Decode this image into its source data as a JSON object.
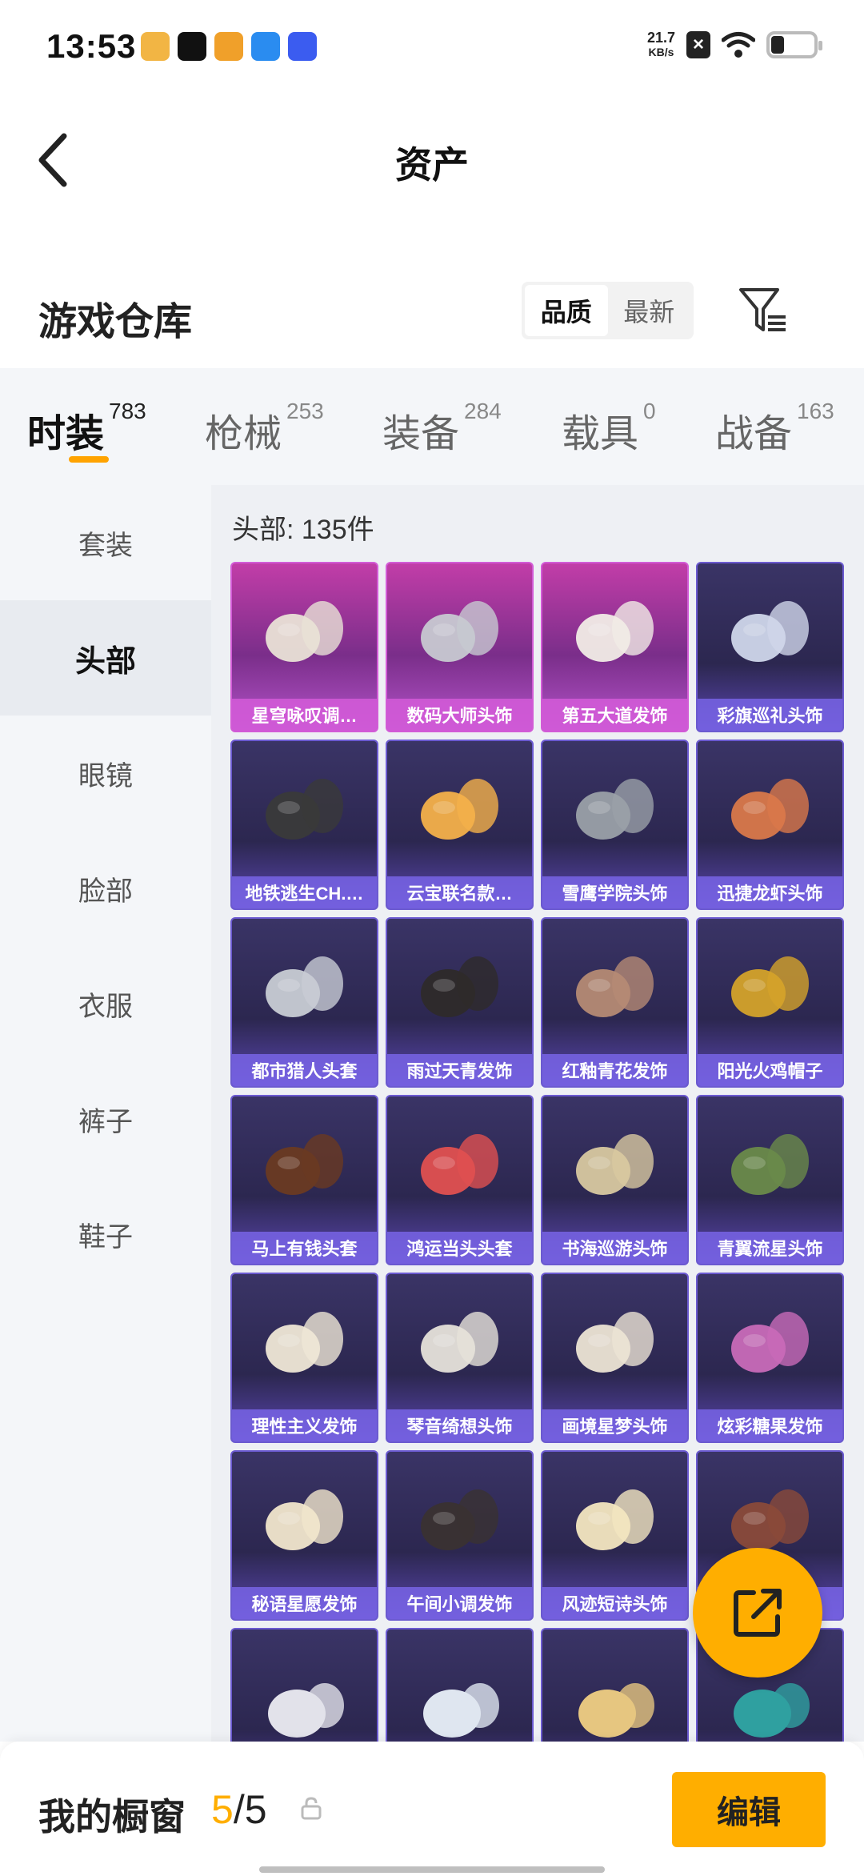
{
  "status": {
    "time": "13:53",
    "speed_top": "21.7",
    "speed_bottom": "KB/s",
    "icons": [
      "app-icon",
      "app-icon",
      "app-icon",
      "app-icon",
      "app-icon",
      "close-icon",
      "wifi-icon",
      "battery-icon"
    ]
  },
  "header": {
    "title": "资产"
  },
  "warehouse": {
    "title": "游戏仓库",
    "sort_quality": "品质",
    "sort_newest": "最新"
  },
  "tabs": [
    {
      "label": "时装",
      "count": "783"
    },
    {
      "label": "枪械",
      "count": "253"
    },
    {
      "label": "装备",
      "count": "284"
    },
    {
      "label": "载具",
      "count": "0"
    },
    {
      "label": "战备",
      "count": "163"
    }
  ],
  "sidebar": [
    "套装",
    "头部",
    "眼镜",
    "脸部",
    "衣服",
    "裤子",
    "鞋子"
  ],
  "content": {
    "title": "头部: 135件",
    "items": [
      {
        "name": "星穹咏叹调…",
        "rarity": "pink"
      },
      {
        "name": "数码大师头饰",
        "rarity": "pink"
      },
      {
        "name": "第五大道发饰",
        "rarity": "pink"
      },
      {
        "name": "彩旗巡礼头饰",
        "rarity": "purple"
      },
      {
        "name": "地铁逃生CH.…",
        "rarity": "purple"
      },
      {
        "name": "云宝联名款…",
        "rarity": "purple"
      },
      {
        "name": "雪鹰学院头饰",
        "rarity": "purple"
      },
      {
        "name": "迅捷龙虾头饰",
        "rarity": "purple"
      },
      {
        "name": "都市猎人头套",
        "rarity": "purple"
      },
      {
        "name": "雨过天青发饰",
        "rarity": "purple"
      },
      {
        "name": "红釉青花发饰",
        "rarity": "purple"
      },
      {
        "name": "阳光火鸡帽子",
        "rarity": "purple"
      },
      {
        "name": "马上有钱头套",
        "rarity": "purple"
      },
      {
        "name": "鸿运当头头套",
        "rarity": "purple"
      },
      {
        "name": "书海巡游头饰",
        "rarity": "purple"
      },
      {
        "name": "青翼流星头饰",
        "rarity": "purple"
      },
      {
        "name": "理性主义发饰",
        "rarity": "purple"
      },
      {
        "name": "琴音绮想头饰",
        "rarity": "purple"
      },
      {
        "name": "画境星梦头饰",
        "rarity": "purple"
      },
      {
        "name": "炫彩糖果发饰",
        "rarity": "purple"
      },
      {
        "name": "秘语星愿发饰",
        "rarity": "purple"
      },
      {
        "name": "午间小调发饰",
        "rarity": "purple"
      },
      {
        "name": "风迹短诗头饰",
        "rarity": "purple"
      },
      {
        "name": "饰",
        "rarity": "purple"
      }
    ]
  },
  "bottom": {
    "label": "我的橱窗",
    "current": "5",
    "total": "/5",
    "edit": "编辑"
  },
  "colors": {
    "accent": "#ffae00",
    "pink_card": "#c23da8",
    "purple_card": "#3a3466"
  }
}
